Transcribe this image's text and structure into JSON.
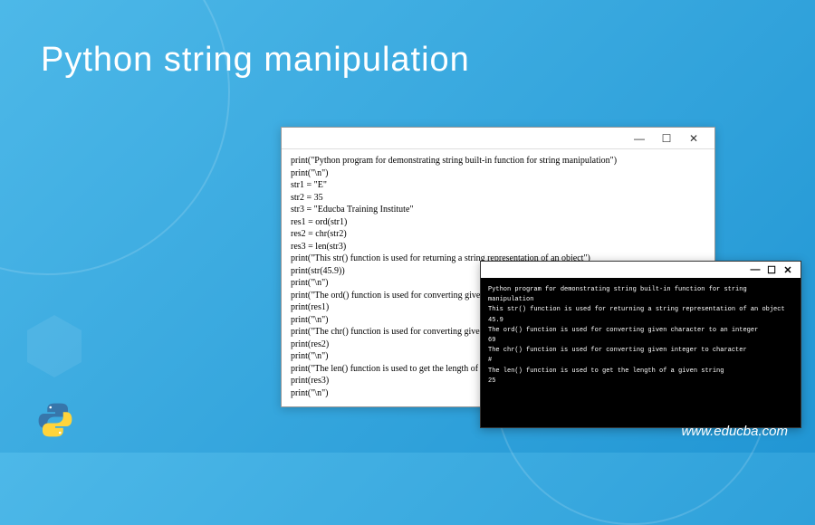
{
  "title": "Python string manipulation",
  "website": "www.educba.com",
  "codeWindow": {
    "lines": [
      "print(\"Python program for demonstrating string built-in function for string manipulation\")",
      "print(\"\\n\")",
      "str1 = \"E\"",
      "str2 = 35",
      "str3 = \"Educba Training Institute\"",
      "res1 = ord(str1)",
      "res2 = chr(str2)",
      "res3 = len(str3)",
      "print(\"This str() function is used for returning a string representation of an object\")",
      "print(str(45.9))",
      "print(\"\\n\")",
      "print(\"The ord() function is used for converting given character to an integer\")",
      "print(res1)",
      "print(\"\\n\")",
      "print(\"The chr() function is used for converting given integer to character\")",
      "print(res2)",
      "print(\"\\n\")",
      "print(\"The len() function is used to get the length of a given string\")",
      "print(res3)",
      "print(\"\\n\")"
    ]
  },
  "terminalWindow": {
    "lines": [
      "Python program for demonstrating string built-in function for string manipulation",
      "",
      "This str() function is used for returning a string representation of an object",
      "45.9",
      "",
      "The ord() function is used for converting given character to an integer",
      "69",
      "",
      "The chr() function is used for converting given integer to character",
      "#",
      "",
      "The len() function is used to get the length of a given string",
      "25"
    ]
  },
  "windowControls": {
    "minimize": "—",
    "maximize": "☐",
    "close": "✕"
  }
}
